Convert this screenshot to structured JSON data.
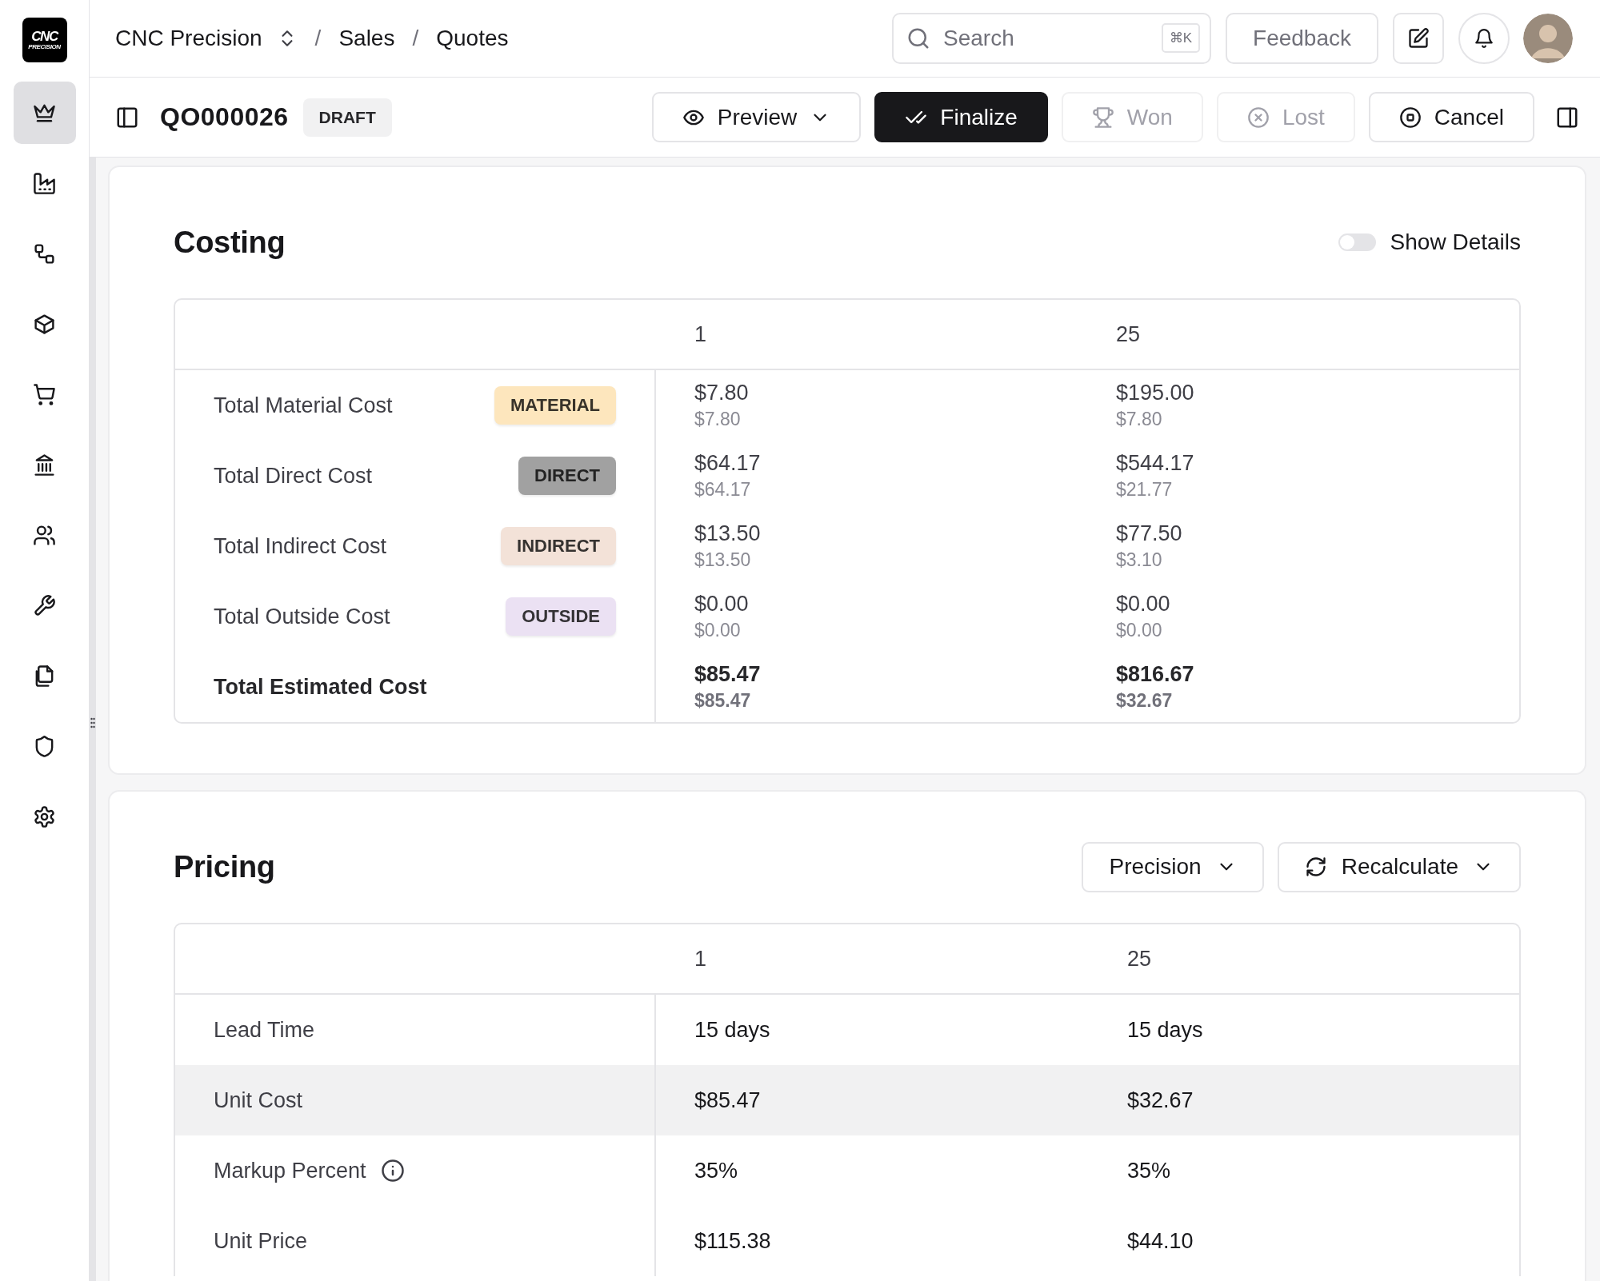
{
  "logo": {
    "text": "CNC",
    "subtext": "PRECISION"
  },
  "sidebar": {
    "items": [
      {
        "selected": true
      },
      {
        "selected": false
      },
      {
        "selected": false
      },
      {
        "selected": false
      },
      {
        "selected": false
      },
      {
        "selected": false
      },
      {
        "selected": false
      },
      {
        "selected": false
      },
      {
        "selected": false
      },
      {
        "selected": false
      },
      {
        "selected": false
      }
    ]
  },
  "topbar": {
    "breadcrumbs": [
      "CNC Precision",
      "Sales",
      "Quotes"
    ],
    "separator": "/",
    "search": {
      "placeholder": "Search",
      "shortcut": "⌘K"
    },
    "feedback": "Feedback"
  },
  "toolbar": {
    "title": "QO000026",
    "status": "DRAFT",
    "buttons": [
      {
        "label": "Preview",
        "kind": "outline",
        "disabled": false,
        "dropdown": true
      },
      {
        "label": "Finalize",
        "kind": "primary",
        "disabled": false,
        "dropdown": false
      },
      {
        "label": "Won",
        "kind": "outline",
        "disabled": true,
        "dropdown": false
      },
      {
        "label": "Lost",
        "kind": "outline",
        "disabled": true,
        "dropdown": false
      },
      {
        "label": "Cancel",
        "kind": "outline",
        "disabled": false,
        "dropdown": false
      }
    ]
  },
  "costing": {
    "title": "Costing",
    "show_details": {
      "label": "Show Details",
      "on": false
    },
    "columns": [
      "1",
      "25"
    ],
    "rows": [
      {
        "label": "Total Material Cost",
        "kind": "line",
        "tag": "MATERIAL",
        "color": "#fde6bd",
        "values": [
          {
            "main": "$7.80",
            "sub": "$7.80"
          },
          {
            "main": "$195.00",
            "sub": "$7.80"
          }
        ]
      },
      {
        "label": "Total Direct Cost",
        "kind": "line",
        "tag": "DIRECT",
        "color": "#a1a1a1",
        "values": [
          {
            "main": "$64.17",
            "sub": "$64.17"
          },
          {
            "main": "$544.17",
            "sub": "$21.77"
          }
        ]
      },
      {
        "label": "Total Indirect Cost",
        "kind": "line",
        "tag": "INDIRECT",
        "color": "#f3e2d8",
        "values": [
          {
            "main": "$13.50",
            "sub": "$13.50"
          },
          {
            "main": "$77.50",
            "sub": "$3.10"
          }
        ]
      },
      {
        "label": "Total Outside Cost",
        "kind": "line",
        "tag": "OUTSIDE",
        "color": "#ebe1f3",
        "values": [
          {
            "main": "$0.00",
            "sub": "$0.00"
          },
          {
            "main": "$0.00",
            "sub": "$0.00"
          }
        ]
      },
      {
        "label": "Total Estimated Cost",
        "kind": "total",
        "values": [
          {
            "main": "$85.47",
            "sub": "$85.47"
          },
          {
            "main": "$816.67",
            "sub": "$32.67"
          }
        ]
      }
    ]
  },
  "pricing": {
    "title": "Pricing",
    "controls": [
      {
        "label": "Precision",
        "kind": "select"
      },
      {
        "label": "Recalculate",
        "kind": "action"
      }
    ],
    "columns": [
      "1",
      "25"
    ],
    "rows": [
      {
        "label": "Lead Time",
        "highlighted": false,
        "info": false,
        "values": [
          "15 days",
          "15 days"
        ]
      },
      {
        "label": "Unit Cost",
        "highlighted": true,
        "info": false,
        "values": [
          "$85.47",
          "$32.67"
        ]
      },
      {
        "label": "Markup Percent",
        "highlighted": false,
        "info": true,
        "values": [
          "35%",
          "35%"
        ]
      },
      {
        "label": "Unit Price",
        "highlighted": false,
        "info": false,
        "values": [
          "$115.38",
          "$44.10"
        ]
      }
    ]
  }
}
